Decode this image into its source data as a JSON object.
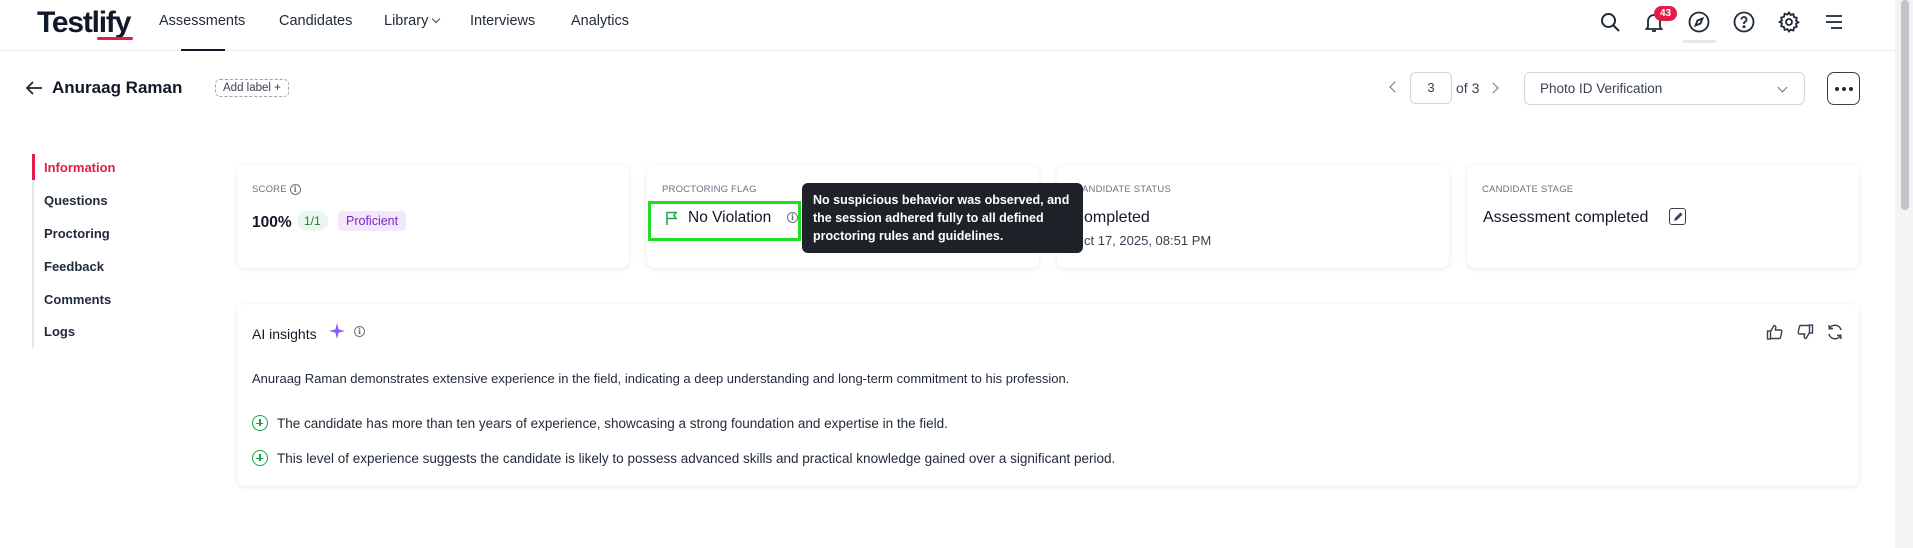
{
  "brand": {
    "logo_text": "Testlify",
    "accent": "#e11d48"
  },
  "nav": {
    "items": [
      {
        "label": "Assessments",
        "active": true
      },
      {
        "label": "Candidates"
      },
      {
        "label": "Library"
      },
      {
        "label": "Interviews"
      },
      {
        "label": "Analytics"
      }
    ],
    "notification_count": "43",
    "icons": [
      "search-icon",
      "bell-icon",
      "compass-icon",
      "help-icon",
      "gear-icon",
      "menu-icon"
    ]
  },
  "candidate": {
    "name": "Anuraag Raman",
    "add_label": "Add label +"
  },
  "pagination": {
    "current": "3",
    "of_text": "of 3"
  },
  "section_select": {
    "value": "Photo ID Verification"
  },
  "side_menu": {
    "items": [
      {
        "label": "Information",
        "active": true
      },
      {
        "label": "Questions"
      },
      {
        "label": "Proctoring"
      },
      {
        "label": "Feedback"
      },
      {
        "label": "Comments"
      },
      {
        "label": "Logs"
      }
    ]
  },
  "cards": {
    "score": {
      "label": "SCORE",
      "value": "100%",
      "ratio": "1/1",
      "level": "Proficient"
    },
    "proctoring": {
      "label": "PROCTORING FLAG",
      "value": "No Violation"
    },
    "status": {
      "label": "ANDIDATE STATUS",
      "value": "ompleted",
      "date": "ct 17, 2025, 08:51 PM"
    },
    "stage": {
      "label": "CANDIDATE STAGE",
      "value": "Assessment completed"
    }
  },
  "tooltip": {
    "text": "No suspicious behavior was observed, and the session adhered fully to all defined proctoring rules and guidelines."
  },
  "ai_insights": {
    "title": "AI insights",
    "summary": "Anuraag Raman demonstrates extensive experience in the field, indicating a deep understanding and long-term commitment to his profession.",
    "points": [
      "The candidate has more than ten years of experience, showcasing a strong foundation and expertise in the field.",
      "This level of experience suggests the candidate is likely to possess advanced skills and practical knowledge gained over a significant period."
    ]
  }
}
